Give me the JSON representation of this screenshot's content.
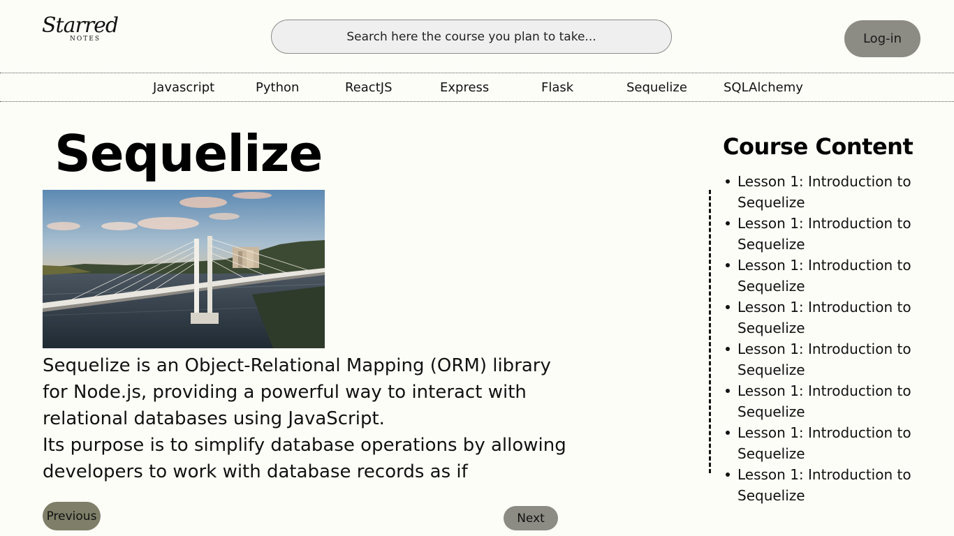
{
  "brand": {
    "logo_script": "Starred",
    "logo_sub": "NOTES"
  },
  "search": {
    "placeholder": "Search here the course you plan to take..."
  },
  "header": {
    "login_label": "Log-in"
  },
  "nav": {
    "items": [
      {
        "label": "Javascript"
      },
      {
        "label": "Python"
      },
      {
        "label": "ReactJS"
      },
      {
        "label": "Express"
      },
      {
        "label": "Flask"
      },
      {
        "label": "Sequelize"
      },
      {
        "label": "SQLAlchemy"
      }
    ]
  },
  "main": {
    "title": "Sequelize",
    "description": [
      "Sequelize is an Object-Relational Mapping (ORM) library for Node.js, providing a powerful way to interact with relational databases using JavaScript.",
      "Its purpose is to simplify database operations by allowing developers to work with database records as if"
    ],
    "prev_label": "Previous",
    "next_label": "Next"
  },
  "sidebar": {
    "title": "Course Content",
    "lessons": [
      {
        "label": "Lesson 1: Introduction to Sequelize"
      },
      {
        "label": "Lesson 1: Introduction to Sequelize"
      },
      {
        "label": "Lesson 1: Introduction to Sequelize"
      },
      {
        "label": "Lesson 1: Introduction to Sequelize"
      },
      {
        "label": "Lesson 1: Introduction to Sequelize"
      },
      {
        "label": "Lesson 1: Introduction to Sequelize"
      },
      {
        "label": "Lesson 1: Introduction to Sequelize"
      },
      {
        "label": "Lesson 1: Introduction to Sequelize"
      }
    ]
  },
  "colors": {
    "background": "#fdfdf8",
    "login_button": "#8c8c84",
    "previous_button": "#7f7f69",
    "next_button": "#8c8c84",
    "search_fill": "#efefef"
  }
}
